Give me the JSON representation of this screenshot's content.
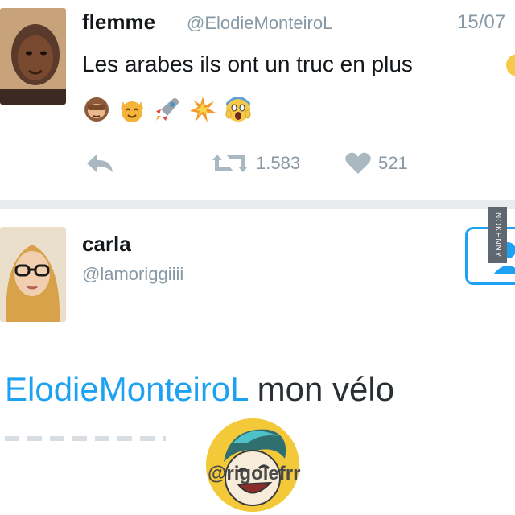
{
  "tweet1": {
    "name": "flemme",
    "handle": "@ElodieMonteiroL",
    "date": "15/07",
    "text": "Les arabes ils ont un truc en plus",
    "emoji_icons": [
      "see-no-evil-monkey-icon",
      "cat-icon",
      "rocket-icon",
      "collision-icon",
      "scream-icon"
    ],
    "retweets": "1.583",
    "likes": "521"
  },
  "tweet2": {
    "name": "carla",
    "handle": "@lamoriggiiii",
    "reply_mention": "ElodieMonteiroL",
    "reply_body": " mon vélo"
  },
  "watermark": {
    "side_badge": "NOKENNY",
    "logo_text": "@rigolefrr"
  },
  "colors": {
    "accent": "#1da1f2",
    "muted": "#8899a6",
    "divider": "#e9ecef"
  }
}
